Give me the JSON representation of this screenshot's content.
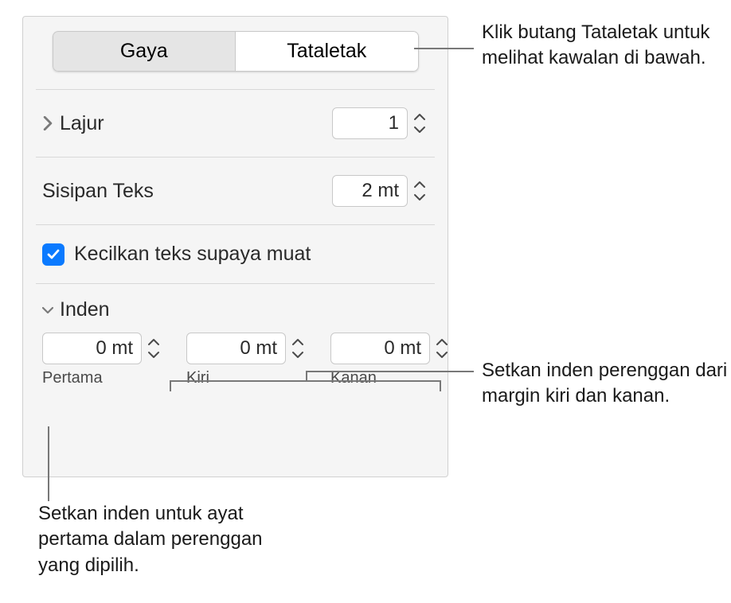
{
  "tabs": {
    "style": "Gaya",
    "layout": "Tataletak"
  },
  "columns": {
    "label": "Lajur",
    "value": "1"
  },
  "textInset": {
    "label": "Sisipan Teks",
    "value": "2 mt"
  },
  "shrinkText": {
    "label": "Kecilkan teks supaya muat",
    "checked": true
  },
  "indents": {
    "label": "Inden",
    "first": {
      "label": "Pertama",
      "value": "0 mt"
    },
    "left": {
      "label": "Kiri",
      "value": "0 mt"
    },
    "right": {
      "label": "Kanan",
      "value": "0 mt"
    }
  },
  "callouts": {
    "layoutTab": "Klik butang Tataletak untuk melihat kawalan di bawah.",
    "leftRight": "Setkan inden perenggan dari margin kiri dan kanan.",
    "first": "Setkan inden untuk ayat pertama dalam perenggan yang dipilih."
  }
}
